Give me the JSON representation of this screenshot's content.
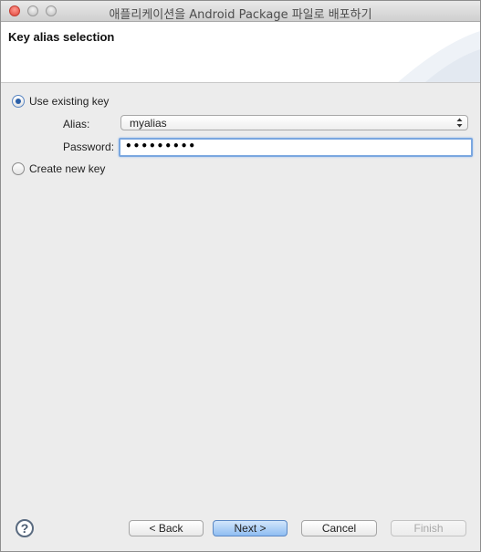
{
  "window": {
    "title": "애플리케이션을 Android Package 파일로 배포하기"
  },
  "header": {
    "title": "Key alias selection"
  },
  "form": {
    "use_existing_label": "Use existing key",
    "alias_label": "Alias:",
    "alias_value": "myalias",
    "password_label": "Password:",
    "password_value": "•••••••••",
    "create_new_label": "Create new key",
    "selected_option": "Use existing key"
  },
  "footer": {
    "help_glyph": "?",
    "back_label": "< Back",
    "next_label": "Next >",
    "cancel_label": "Cancel",
    "finish_label": "Finish"
  },
  "colors": {
    "default_button": "#8fbdf2",
    "focus_ring": "#7aa7e0",
    "close_button": "#e0443a"
  }
}
